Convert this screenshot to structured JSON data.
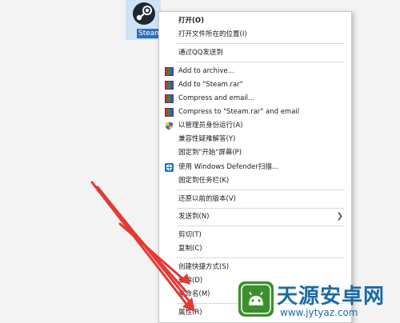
{
  "desktop": {
    "icon_label": "Steam"
  },
  "menu": {
    "items": [
      {
        "label": "打开(O)",
        "bold": true
      },
      {
        "label": "打开文件所在的位置(I)"
      },
      {
        "label": "通过QQ发送到"
      },
      {
        "label": "Add to archive...",
        "icon": "winrar-icon"
      },
      {
        "label": "Add to \"Steam.rar\"",
        "icon": "winrar-icon"
      },
      {
        "label": "Compress and email...",
        "icon": "winrar-icon"
      },
      {
        "label": "Compress to \"Steam.rar\" and email",
        "icon": "winrar-icon"
      },
      {
        "label": "以管理员身份运行(A)",
        "icon": "uac-shield-icon"
      },
      {
        "label": "兼容性疑难解答(Y)"
      },
      {
        "label": "固定到\"开始\"屏幕(P)"
      },
      {
        "label": "使用 Windows Defender扫描...",
        "icon": "windows-defender-icon"
      },
      {
        "label": "固定到任务栏(K)"
      },
      {
        "label": "还原以前的版本(V)"
      },
      {
        "label": "发送到(N)",
        "submenu_icon": "chevron-right-icon"
      },
      {
        "label": "剪切(T)"
      },
      {
        "label": "复制(C)"
      },
      {
        "label": "创建快捷方式(S)"
      },
      {
        "label": "删除(D)"
      },
      {
        "label": "重命名(M)"
      },
      {
        "label": "属性(R)"
      }
    ]
  },
  "watermark": {
    "title": "天源安卓网",
    "url": "www.jytyaz.com"
  },
  "colors": {
    "arrow": "#e53935",
    "watermark": "#1b6aa6"
  }
}
